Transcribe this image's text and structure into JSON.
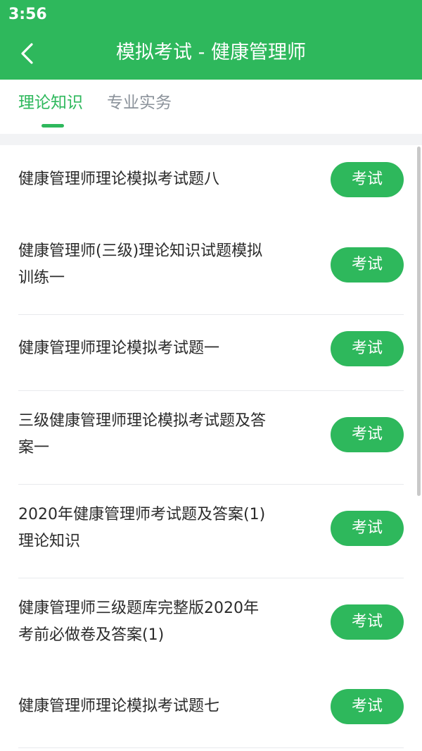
{
  "status_bar": {
    "time": "3:56"
  },
  "header": {
    "title": "模拟考试 - 健康管理师"
  },
  "tabs": [
    {
      "label": "理论知识",
      "active": true
    },
    {
      "label": "专业实务",
      "active": false
    }
  ],
  "exam_button_label": "考试",
  "exams": [
    {
      "title": "健康管理师理论模拟考试题八"
    },
    {
      "title": "健康管理师(三级)理论知识试题模拟训练一"
    },
    {
      "title": "健康管理师理论模拟考试题一"
    },
    {
      "title": "三级健康管理师理论模拟考试题及答案一"
    },
    {
      "title": "2020年健康管理师考试题及答案(1)理论知识"
    },
    {
      "title": "健康管理师三级题库完整版2020年考前必做卷及答案(1)"
    },
    {
      "title": "健康管理师理论模拟考试题七"
    }
  ],
  "colors": {
    "primary": "#2eb85c",
    "inactive_tab": "#8c939b",
    "text": "#2b2b2b"
  }
}
